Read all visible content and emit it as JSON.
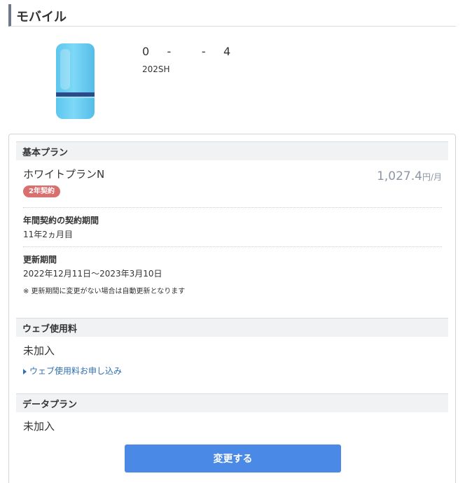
{
  "section": {
    "title": "モバイル"
  },
  "device": {
    "phone_number": "0    -       -    4",
    "model": "202SH"
  },
  "basic_plan": {
    "header": "基本プラン",
    "plan_name": "ホワイトプランN",
    "price": "1,027.4",
    "price_unit": "円/月",
    "contract_badge": "2年契約",
    "period_label": "年間契約の契約期間",
    "period_value": "11年2ヵ月目",
    "renewal_label": "更新期間",
    "renewal_value": "2022年12月11日～2023年3月10日",
    "renewal_note": "※ 更新期間に変更がない場合は自動更新となります"
  },
  "web_fee": {
    "header": "ウェブ使用料",
    "status": "未加入",
    "apply_link": "ウェブ使用料お申し込み"
  },
  "data_plan": {
    "header": "データプラン",
    "status": "未加入"
  },
  "actions": {
    "change_label": "変更する"
  },
  "colors": {
    "accent": "#4a8ae6",
    "badge": "#d9706f",
    "link": "#2f6fb5",
    "price": "#8c96a5"
  }
}
